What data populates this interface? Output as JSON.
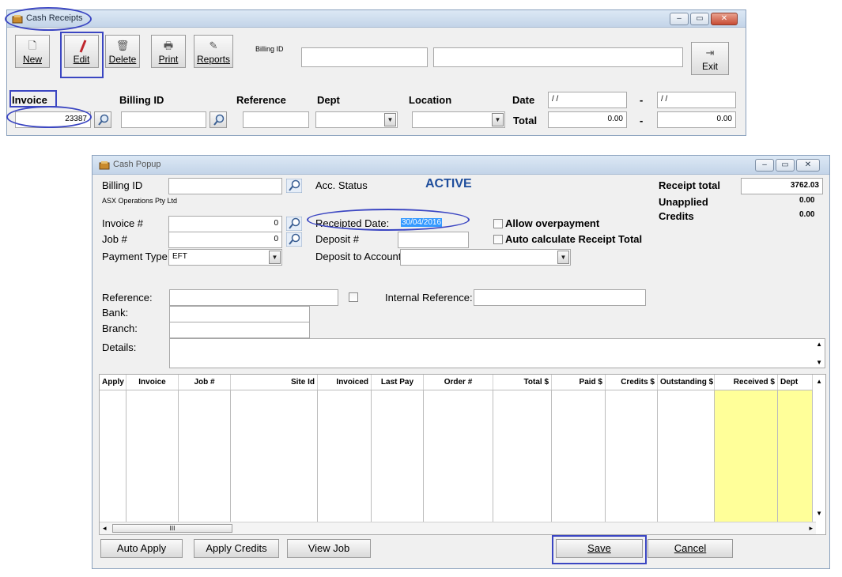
{
  "cash_receipts": {
    "title": "Cash Receipts",
    "toolbar": {
      "new": "New",
      "edit": "Edit",
      "delete": "Delete",
      "print": "Print",
      "reports": "Reports",
      "exit": "Exit",
      "billing_id_label": "Billing ID"
    },
    "filter": {
      "invoice_label": "Invoice",
      "billing_id_label": "Billing ID",
      "reference_label": "Reference",
      "dept_label": "Dept",
      "location_label": "Location",
      "date_label": "Date",
      "total_label": "Total",
      "invoice_value": "23387",
      "date_from": "/ /",
      "date_to": "/ /",
      "dash": "-",
      "total_from": "0.00",
      "total_to": "0.00"
    }
  },
  "cash_popup": {
    "title": "Cash Popup",
    "billing_id_label": "Billing ID",
    "company_name": "ASX Operations Pty Ltd",
    "acc_status_label": "Acc. Status",
    "acc_status_value": "ACTIVE",
    "receipt_total_label": "Receipt total",
    "receipt_total_value": "3762.03",
    "unapplied_label": "Unapplied",
    "unapplied_value": "0.00",
    "credits_label": "Credits",
    "credits_value": "0.00",
    "invoice_label": "Invoice #",
    "invoice_value": "0",
    "job_label": "Job #",
    "job_value": "0",
    "payment_type_label": "Payment Type",
    "payment_type_value": "EFT",
    "receipted_date_label": "Receipted Date:",
    "receipted_date_value": "30/04/2016",
    "deposit_label": "Deposit #",
    "deposit_account_label": "Deposit to Account:",
    "allow_overpayment_label": "Allow overpayment",
    "auto_calc_label": "Auto calculate Receipt Total",
    "reference_label": "Reference:",
    "internal_reference_label": "Internal Reference:",
    "bank_label": "Bank:",
    "branch_label": "Branch:",
    "details_label": "Details:",
    "grid_columns": [
      "Apply",
      "Invoice",
      "Job #",
      "Site Id",
      "Invoiced",
      "Last Pay",
      "Order #",
      "Total $",
      "Paid $",
      "Credits $",
      "Outstanding $",
      "Received $",
      "Dept"
    ],
    "buttons": {
      "auto_apply": "Auto Apply",
      "apply_credits": "Apply Credits",
      "view_job": "View Job",
      "save": "Save",
      "cancel": "Cancel"
    },
    "scroll_grip": "III"
  },
  "colors": {
    "highlight": "#3b46c2",
    "active": "#1f4e9c",
    "received_column": "#ffff99"
  }
}
